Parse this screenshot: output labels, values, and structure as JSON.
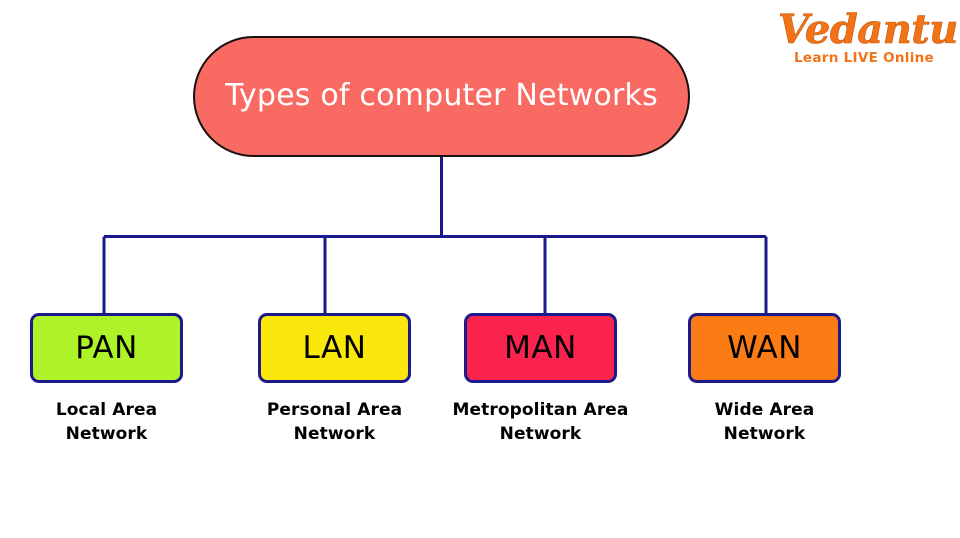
{
  "brand": {
    "name": "Vedantu",
    "tagline": "Learn LIVE Online",
    "color": "#F47216"
  },
  "diagram": {
    "type": "tree",
    "root": {
      "label": "Types of computer\nNetworks",
      "fill": "#F96A63",
      "text_color": "#FFFFFF",
      "border_color": "#1A1010",
      "shape": "stadium"
    },
    "connector_color": "#1A1A8C",
    "nodes": [
      {
        "abbr": "PAN",
        "caption": "Local Area\nNetwork",
        "fill": "#AEF328",
        "border_color": "#1A1A8C",
        "text_color": "#000000"
      },
      {
        "abbr": "LAN",
        "caption": "Personal Area\nNetwork",
        "fill": "#FAE70C",
        "border_color": "#1A1A8C",
        "text_color": "#000000"
      },
      {
        "abbr": "MAN",
        "caption": "Metropolitan Area\nNetwork",
        "fill": "#F9234E",
        "border_color": "#1A1A8C",
        "text_color": "#000000"
      },
      {
        "abbr": "WAN",
        "caption": "Wide Area\nNetwork",
        "fill": "#FB7B14",
        "border_color": "#1A1A8C",
        "text_color": "#000000"
      }
    ]
  }
}
